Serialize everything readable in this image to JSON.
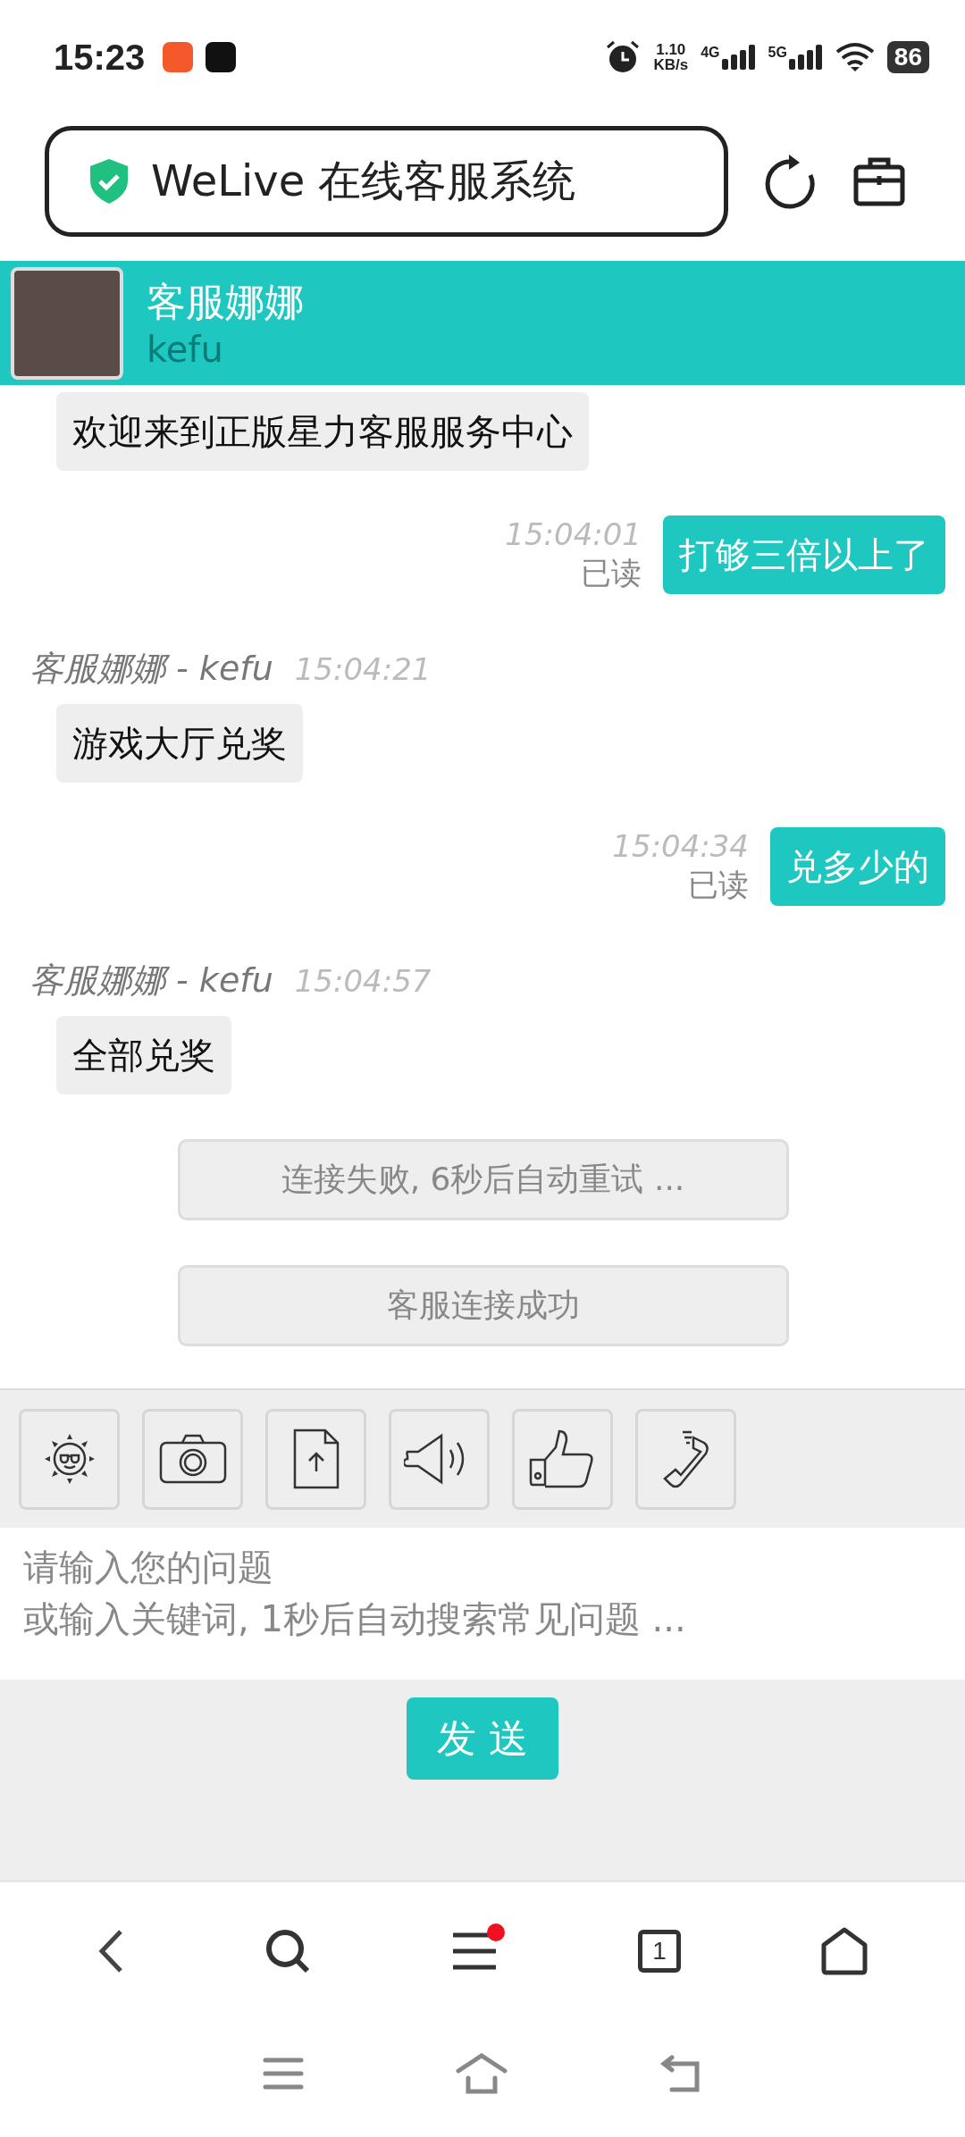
{
  "status_bar": {
    "time": "15:23",
    "net_speed": "1.10",
    "net_unit": "KB/s",
    "signal_1": "4G",
    "signal_2": "5G",
    "battery": "86"
  },
  "address_bar": {
    "title": "WeLive 在线客服系统"
  },
  "chat_header": {
    "name": "客服娜娜",
    "account": "kefu"
  },
  "messages": [
    {
      "kind": "agent",
      "text": "欢迎来到正版星力客服服务中心"
    },
    {
      "kind": "user",
      "time": "15:04:01",
      "receipt": "已读",
      "text": "打够三倍以上了"
    },
    {
      "kind": "agent",
      "sender": "客服娜娜 - kefu",
      "time": "15:04:21",
      "text": "游戏大厅兑奖"
    },
    {
      "kind": "user",
      "time": "15:04:34",
      "receipt": "已读",
      "text": "兑多少的"
    },
    {
      "kind": "agent",
      "sender": "客服娜娜 - kefu",
      "time": "15:04:57",
      "text": "全部兑奖"
    },
    {
      "kind": "system",
      "text": "连接失败, 6秒后自动重试 ..."
    },
    {
      "kind": "system",
      "text": "客服连接成功"
    }
  ],
  "tools": [
    {
      "kind": "emoji"
    },
    {
      "kind": "camera"
    },
    {
      "kind": "upload"
    },
    {
      "kind": "sound"
    },
    {
      "kind": "rate"
    },
    {
      "kind": "call"
    }
  ],
  "composer": {
    "placeholder": "请输入您的问题",
    "hint": "或输入关键词, 1秒后自动搜索常见问题 ...",
    "send": "发 送"
  },
  "browser_nav": {
    "tab_count": "1",
    "menu_badge": true
  }
}
